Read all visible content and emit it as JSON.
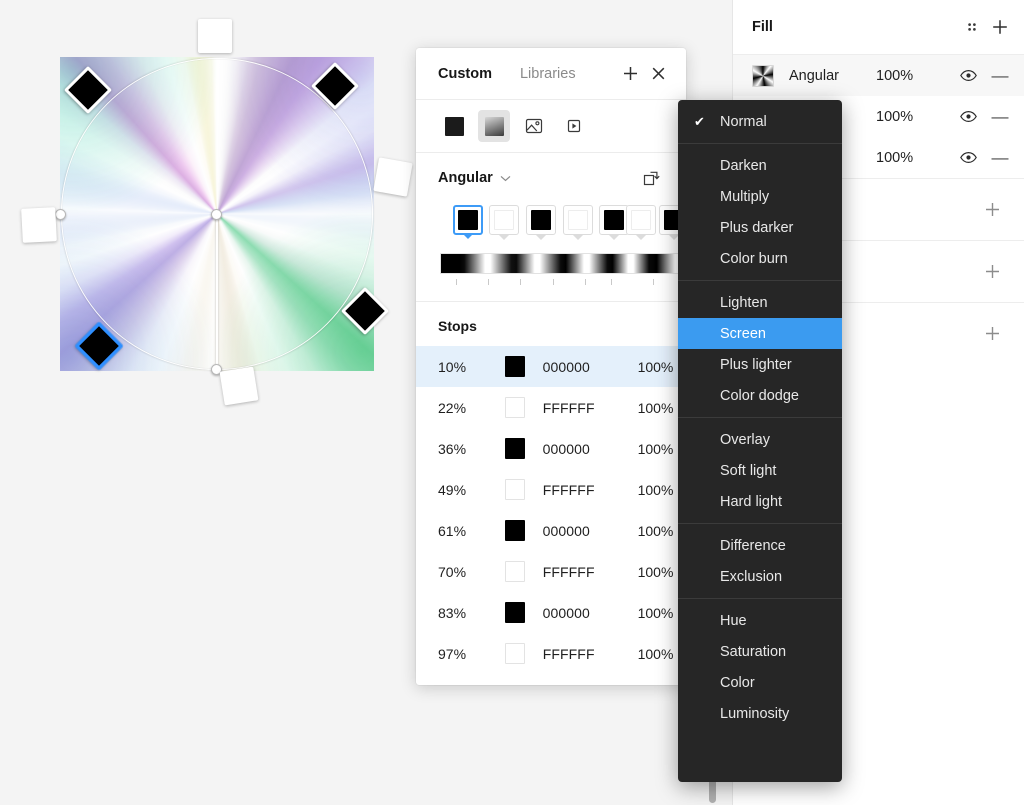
{
  "canvas": {
    "background_color": "#f4f4f4",
    "artboard": {
      "name": "angular-gradient-artboard",
      "gradient_type": "Angular",
      "handles": [
        "center",
        "left",
        "bottom"
      ],
      "stop_chips": [
        {
          "position": "top-left",
          "color": "#000000",
          "selected": false
        },
        {
          "position": "top-right",
          "color": "#000000",
          "selected": false
        },
        {
          "position": "right-upper",
          "color": "#FFFFFF",
          "selected": false
        },
        {
          "position": "right-lower",
          "color": "#000000",
          "selected": false
        },
        {
          "position": "bottom-left",
          "color": "#000000",
          "selected": true
        },
        {
          "position": "bottom-center",
          "color": "#FFFFFF",
          "selected": false
        },
        {
          "position": "left",
          "color": "#FFFFFF",
          "selected": false
        },
        {
          "position": "top-center",
          "color": "#FFFFFF",
          "selected": false
        }
      ]
    }
  },
  "custom_panel": {
    "tabs": [
      {
        "label": "Custom",
        "active": true
      },
      {
        "label": "Libraries",
        "active": false
      }
    ],
    "add_label": "+",
    "close_label": "✕",
    "tools": [
      {
        "name": "solid-color",
        "selected": false
      },
      {
        "name": "gradient",
        "selected": true
      },
      {
        "name": "image",
        "selected": false
      },
      {
        "name": "video",
        "selected": false
      }
    ],
    "gradient_type": "Angular",
    "caret": "⌄",
    "rotate_label": "rotate",
    "chips": [
      {
        "color": "#000000",
        "active": true
      },
      {
        "color": "#FFFFFF",
        "active": false
      },
      {
        "color": "#000000",
        "active": false
      },
      {
        "color": "#FFFFFF",
        "active": false
      },
      {
        "color": "#000000",
        "active": false
      },
      {
        "color": "#FFFFFF",
        "active": false
      },
      {
        "color": "#000000",
        "active": false
      },
      {
        "color": "#FFFFFF",
        "active": false
      }
    ],
    "stops_title": "Stops",
    "stops_columns": [
      "position",
      "swatch",
      "hex",
      "opacity"
    ],
    "stops": [
      {
        "pos": "10%",
        "hex": "000000",
        "opacity": "100%",
        "selected": true
      },
      {
        "pos": "22%",
        "hex": "FFFFFF",
        "opacity": "100%",
        "selected": false
      },
      {
        "pos": "36%",
        "hex": "000000",
        "opacity": "100%",
        "selected": false
      },
      {
        "pos": "49%",
        "hex": "FFFFFF",
        "opacity": "100%",
        "selected": false
      },
      {
        "pos": "61%",
        "hex": "000000",
        "opacity": "100%",
        "selected": false
      },
      {
        "pos": "70%",
        "hex": "FFFFFF",
        "opacity": "100%",
        "selected": false
      },
      {
        "pos": "83%",
        "hex": "000000",
        "opacity": "100%",
        "selected": false
      },
      {
        "pos": "97%",
        "hex": "FFFFFF",
        "opacity": "100%",
        "selected": false
      }
    ]
  },
  "blend_menu": {
    "accent_color": "#3b9bf0",
    "background_color": "#262626",
    "groups": [
      [
        {
          "label": "Normal",
          "checked": true,
          "highlighted": false
        }
      ],
      [
        {
          "label": "Darken",
          "checked": false,
          "highlighted": false
        },
        {
          "label": "Multiply",
          "checked": false,
          "highlighted": false
        },
        {
          "label": "Plus darker",
          "checked": false,
          "highlighted": false
        },
        {
          "label": "Color burn",
          "checked": false,
          "highlighted": false
        }
      ],
      [
        {
          "label": "Lighten",
          "checked": false,
          "highlighted": false
        },
        {
          "label": "Screen",
          "checked": false,
          "highlighted": true
        },
        {
          "label": "Plus lighter",
          "checked": false,
          "highlighted": false
        },
        {
          "label": "Color dodge",
          "checked": false,
          "highlighted": false
        }
      ],
      [
        {
          "label": "Overlay",
          "checked": false,
          "highlighted": false
        },
        {
          "label": "Soft light",
          "checked": false,
          "highlighted": false
        },
        {
          "label": "Hard light",
          "checked": false,
          "highlighted": false
        }
      ],
      [
        {
          "label": "Difference",
          "checked": false,
          "highlighted": false
        },
        {
          "label": "Exclusion",
          "checked": false,
          "highlighted": false
        }
      ],
      [
        {
          "label": "Hue",
          "checked": false,
          "highlighted": false
        },
        {
          "label": "Saturation",
          "checked": false,
          "highlighted": false
        },
        {
          "label": "Color",
          "checked": false,
          "highlighted": false
        },
        {
          "label": "Luminosity",
          "checked": false,
          "highlighted": false
        }
      ]
    ],
    "check_glyph": "✔"
  },
  "right_panel": {
    "title": "Fill",
    "grid_icon": "grid-dots-icon",
    "add_label": "+",
    "fills": [
      {
        "name": "Angular",
        "opacity": "100%",
        "visible": true,
        "highlighted": true
      },
      {
        "name": "",
        "opacity": "100%",
        "visible": true,
        "highlighted": false
      },
      {
        "name": "",
        "opacity": "100%",
        "visible": true,
        "highlighted": false
      }
    ],
    "sections": [
      {
        "add_label": "+"
      },
      {
        "add_label": "+"
      },
      {
        "add_label": "+"
      }
    ],
    "minus_label": "—"
  }
}
